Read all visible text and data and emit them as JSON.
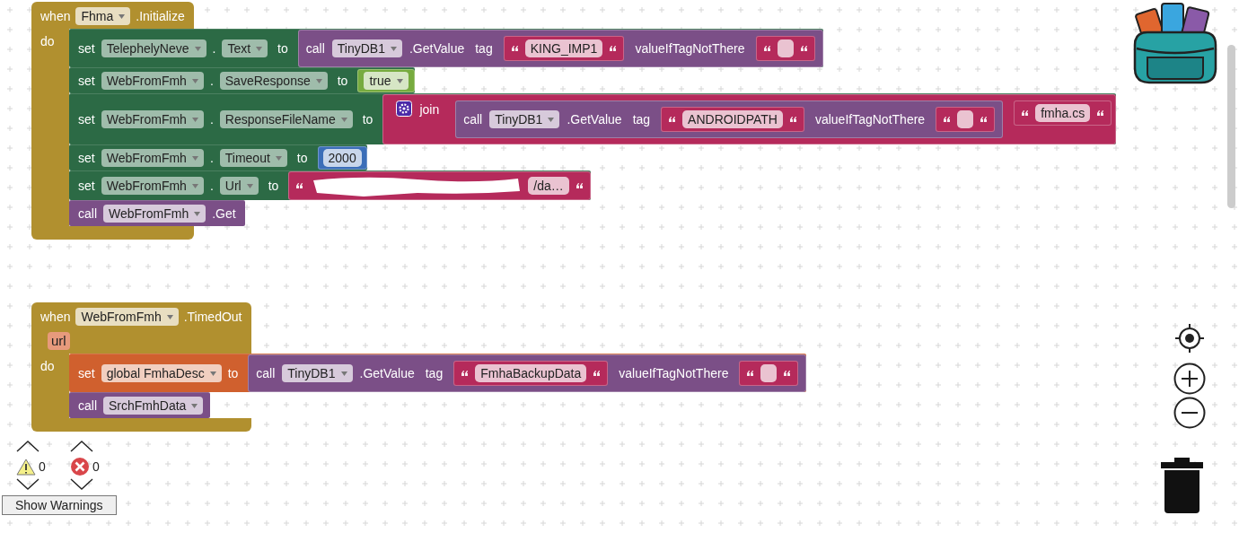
{
  "events": [
    {
      "kind": "component_event",
      "when": "when",
      "component": "Fhma",
      "event": ".Initialize",
      "do": "do",
      "statements": [
        {
          "kind": "set_property",
          "keyword": "set",
          "component": "TelephelyNeve",
          "dot": ".",
          "property": "Text",
          "to": "to",
          "value": {
            "kind": "call_method",
            "keyword": "call",
            "component": "TinyDB1",
            "method": ".GetValue",
            "args": [
              {
                "name": "tag",
                "value": {
                  "kind": "text",
                  "text": "KING_IMP1"
                }
              },
              {
                "name": "valueIfTagNotThere",
                "value": {
                  "kind": "text"
                }
              }
            ]
          }
        },
        {
          "kind": "set_property",
          "keyword": "set",
          "component": "WebFromFmh",
          "dot": ".",
          "property": "SaveResponse",
          "to": "to",
          "value": {
            "kind": "logic",
            "text": "true"
          }
        },
        {
          "kind": "set_property",
          "keyword": "set",
          "component": "WebFromFmh",
          "dot": ".",
          "property": "ResponseFileName",
          "to": "to",
          "value": {
            "kind": "join",
            "keyword": "join",
            "items": [
              {
                "kind": "call_method",
                "keyword": "call",
                "component": "TinyDB1",
                "method": ".GetValue",
                "args": [
                  {
                    "name": "tag",
                    "value": {
                      "kind": "text",
                      "text": "ANDROIDPATH"
                    }
                  },
                  {
                    "name": "valueIfTagNotThere",
                    "value": {
                      "kind": "text"
                    }
                  }
                ]
              },
              {
                "kind": "text",
                "text": "fmha.cs"
              }
            ]
          }
        },
        {
          "kind": "set_property",
          "keyword": "set",
          "component": "WebFromFmh",
          "dot": ".",
          "property": "Timeout",
          "to": "to",
          "value": {
            "kind": "number",
            "text": "2000"
          }
        },
        {
          "kind": "set_property",
          "keyword": "set",
          "component": "WebFromFmh",
          "dot": ".",
          "property": "Url",
          "to": "to",
          "value": {
            "kind": "text",
            "text": "/da…",
            "redacted": true
          }
        },
        {
          "kind": "call_method",
          "keyword": "call",
          "component": "WebFromFmh",
          "method": ".Get"
        }
      ]
    },
    {
      "kind": "component_event",
      "when": "when",
      "component": "WebFromFmh",
      "event": ".TimedOut",
      "params": [
        "url"
      ],
      "do": "do",
      "statements": [
        {
          "kind": "set_global",
          "keyword": "set",
          "variable": "global FmhaDesc",
          "to": "to",
          "value": {
            "kind": "call_method",
            "keyword": "call",
            "component": "TinyDB1",
            "method": ".GetValue",
            "args": [
              {
                "name": "tag",
                "value": {
                  "kind": "text",
                  "text": "FmhaBackupData"
                }
              },
              {
                "name": "valueIfTagNotThere",
                "value": {
                  "kind": "text"
                }
              }
            ]
          }
        },
        {
          "kind": "call_procedure",
          "keyword": "call",
          "procedure": "SrchFmhData"
        }
      ]
    }
  ],
  "warnings": {
    "warning_count": "0",
    "error_count": "0",
    "button": "Show Warnings"
  }
}
